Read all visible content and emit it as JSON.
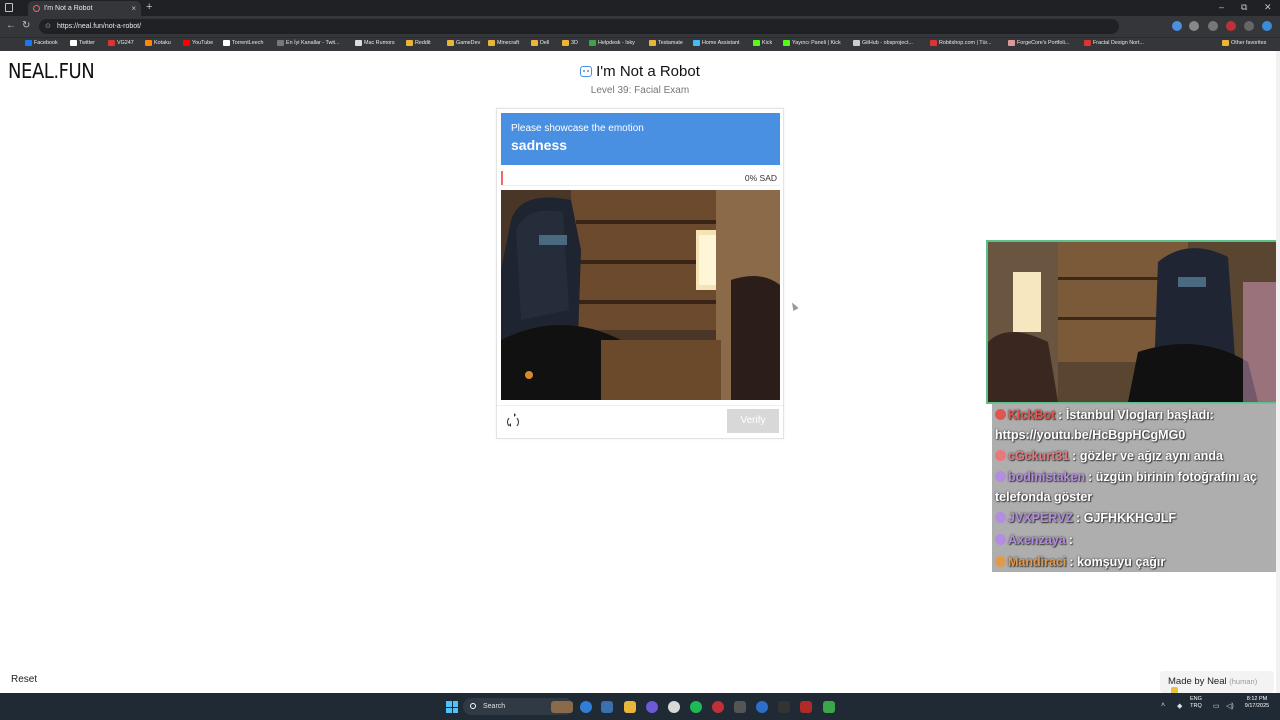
{
  "browser": {
    "tab_title": "I'm Not a Robot",
    "tab_close": "×",
    "new_tab": "+",
    "url": "https://neal.fun/not-a-robot/",
    "window_controls": [
      "–",
      "⧉",
      "✕"
    ],
    "bookmarks": [
      "Facebook",
      "Twitter",
      "VG247",
      "Kotaku",
      "YouTube",
      "TorrentLeech",
      "En İyi Kanallar - Twit...",
      "Mac Rumors",
      "Reddit",
      "GameDev",
      "Minecraft",
      "Dell",
      "3D",
      "Helpdesk - Isky",
      "Testamate",
      "Home Assistant",
      "Kick",
      "Yayıncı Paneli | Kick",
      "GitHub - obsproject...",
      "Robitshop.com | Tür...",
      "ForgeCore's Portfoli...",
      "Fractal Design Nort..."
    ],
    "other_favorites": "Other favorites"
  },
  "page": {
    "logo": "NEAL.FUN",
    "title": "I'm Not a Robot",
    "subtitle": "Level 39: Facial Exam",
    "prompt_line1": "Please showcase the emotion",
    "prompt_line2": "sadness",
    "meter_label": "0% SAD",
    "meter_progress": 0.0,
    "verify_label": "Verify",
    "reset_label": "Reset",
    "made_by": "Made by Neal",
    "made_by_note": "(human)"
  },
  "chat": [
    {
      "user": "KickBot",
      "user_color": "#e0564f",
      "text": "İstanbul Vlogları başladı: https://youtu.be/HcBgpHCgMG0",
      "wrap": true
    },
    {
      "user": "cGckurt31",
      "user_color": "#e8787c",
      "text": "gözler ve ağız aynı anda",
      "wrap": false
    },
    {
      "user": "bodinistaken",
      "user_color": "#b48ce0",
      "text": "üzgün birinin fotoğrafını aç telefonda göster",
      "wrap": true
    },
    {
      "user": "JVXPERVZ",
      "user_color": "#b48ce0",
      "text": "GJFHKKHGJLF",
      "wrap": false
    },
    {
      "user": "Axenzaya",
      "user_color": "#b48ce0",
      "text": "",
      "wrap": false
    },
    {
      "user": "Mandiraci",
      "user_color": "#e09a4f",
      "text": "komşuyu çağır",
      "wrap": false
    }
  ],
  "chat_separator": ":",
  "taskbar": {
    "search_label": "Search",
    "lang": "ENG",
    "lang2": "TRQ",
    "time": "8:12 PM",
    "date": "9/17/2025"
  },
  "colors": {
    "prompt_bg": "#4a90e2",
    "meter_fill": "#ef6a6a",
    "verify_disabled": "#d8d8d8",
    "overlay_border": "#5cc08a"
  }
}
